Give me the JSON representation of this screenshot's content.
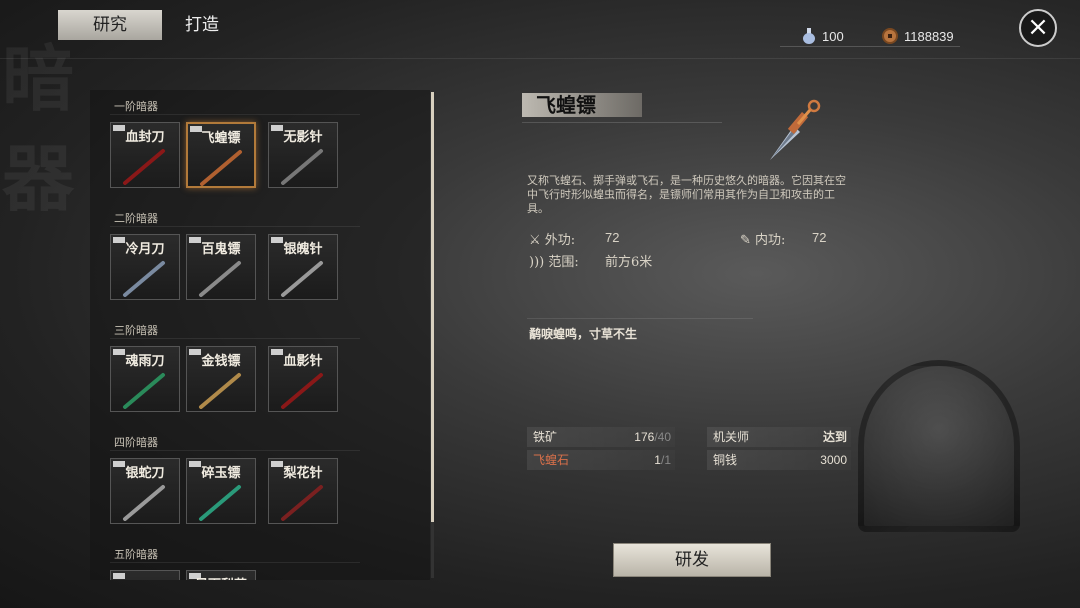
{
  "background_chars": [
    "暗",
    "器"
  ],
  "tabs": [
    {
      "label": "研究",
      "active": true
    },
    {
      "label": "打造",
      "active": false
    }
  ],
  "resources": {
    "potion": {
      "icon": "potion-icon",
      "value": "100"
    },
    "coin": {
      "icon": "coin-icon",
      "value": "1188839"
    }
  },
  "close_icon": "×",
  "tiers": [
    {
      "label": "一阶暗器",
      "items": [
        {
          "name": "血封刀",
          "color": "#8a1818"
        },
        {
          "name": "飞蝗镖",
          "color": "#b06030",
          "selected": true
        },
        {
          "name": "无影针",
          "color": "#777777"
        }
      ]
    },
    {
      "label": "二阶暗器",
      "items": [
        {
          "name": "冷月刀",
          "color": "#7a8aa0"
        },
        {
          "name": "百鬼镖",
          "color": "#8a8a8a"
        },
        {
          "name": "银魄针",
          "color": "#999999"
        }
      ]
    },
    {
      "label": "三阶暗器",
      "items": [
        {
          "name": "魂雨刀",
          "color": "#2a8a5a"
        },
        {
          "name": "金钱镖",
          "color": "#b08a4a"
        },
        {
          "name": "血影针",
          "color": "#8a1818"
        }
      ]
    },
    {
      "label": "四阶暗器",
      "items": [
        {
          "name": "银蛇刀",
          "color": "#9a9a9a"
        },
        {
          "name": "碎玉镖",
          "color": "#2a9a7a"
        },
        {
          "name": "梨花针",
          "color": "#7a2020"
        }
      ]
    },
    {
      "label": "五阶暗器",
      "items": [
        {
          "name": "",
          "color": "#555555"
        },
        {
          "name": "暴雨梨花",
          "color": "#555555"
        }
      ]
    }
  ],
  "detail": {
    "title": "飞蝗镖",
    "description": "又称飞蝗石、掷手弹或飞石，是一种历史悠久的暗器。它因其在空中飞行时形似蝗虫而得名，是镖师们常用其作为自卫和攻击的工具。",
    "stats": {
      "outer_label": "外功:",
      "outer_value": "72",
      "inner_label": "内功:",
      "inner_value": "72",
      "range_label": "范围:",
      "range_value": "前方6米"
    },
    "quote": "鹬唳蝗鸣，寸草不生",
    "materials": [
      {
        "name": "铁矿",
        "have": "176",
        "need": "/40",
        "highlight": false
      },
      {
        "name": "飞蝗石",
        "have": "1",
        "need": "/1",
        "highlight": true
      }
    ],
    "requirements": [
      {
        "name": "机关师",
        "value": "达到"
      },
      {
        "name": "铜钱",
        "value": "3000"
      }
    ],
    "button_label": "研发"
  }
}
